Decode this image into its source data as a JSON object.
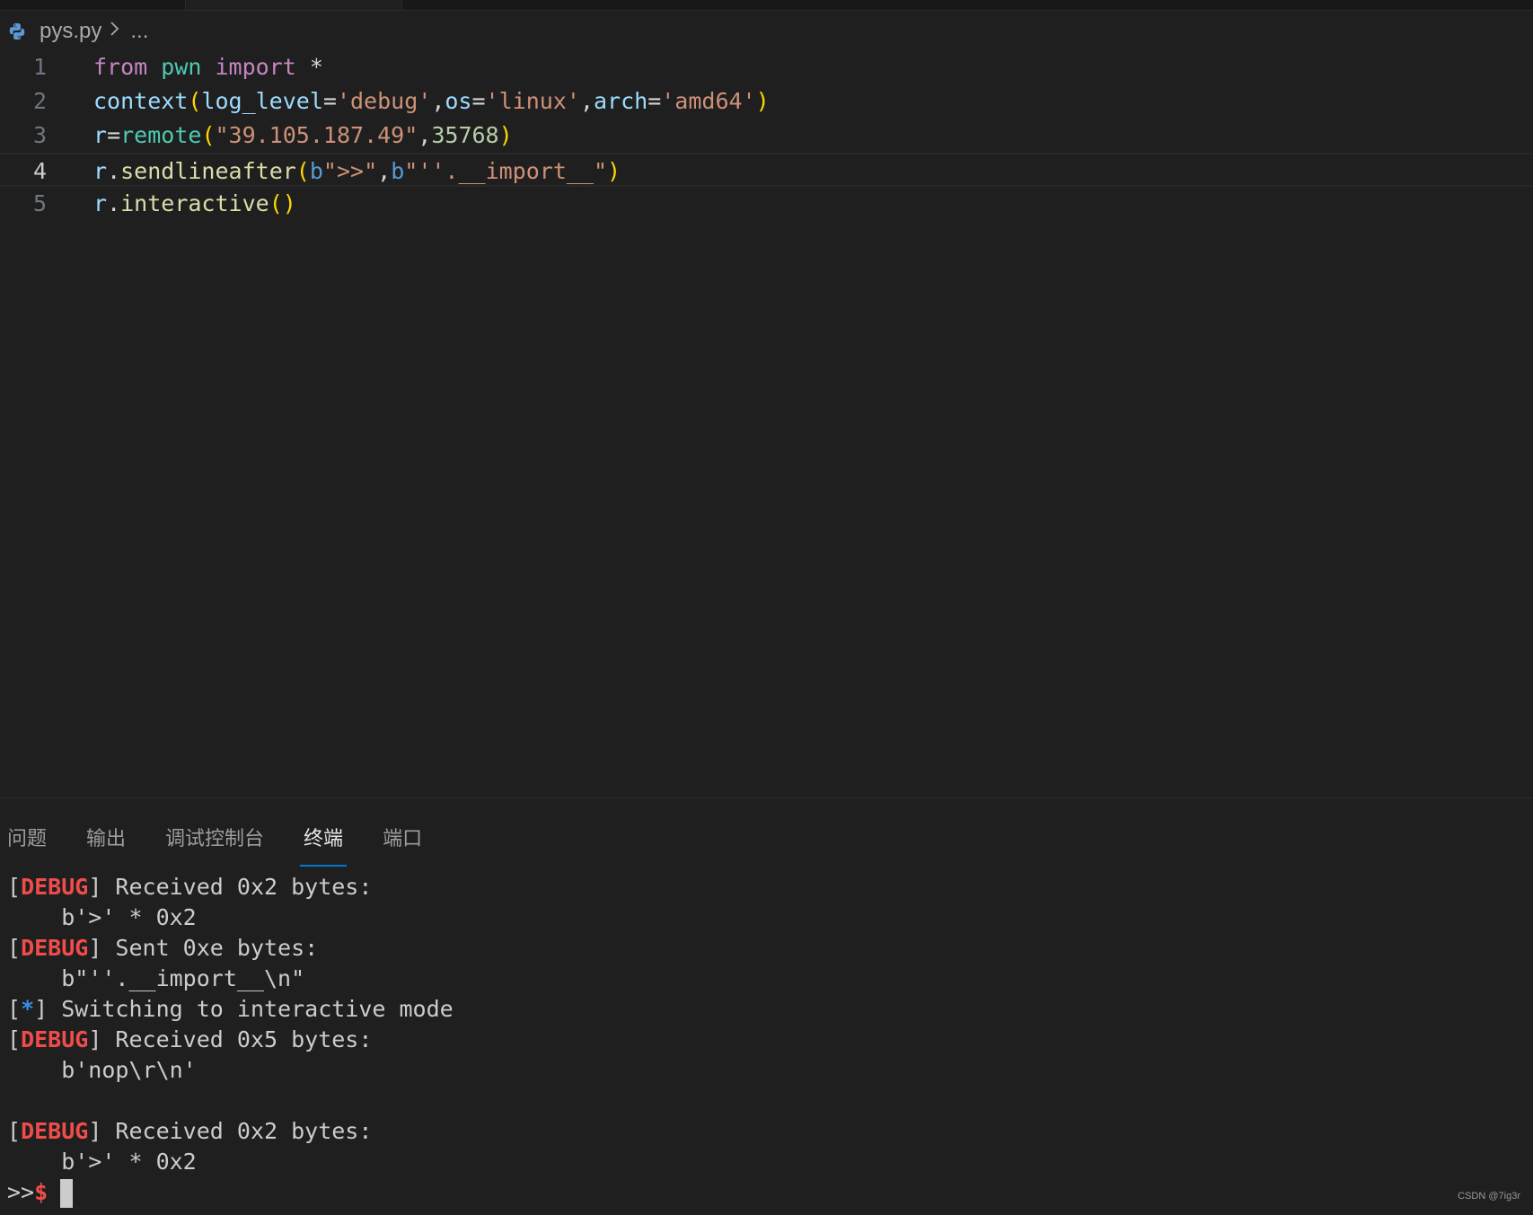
{
  "breadcrumb": {
    "file": "pys.py",
    "more": "...",
    "icon": "python-icon"
  },
  "editor": {
    "line_numbers": [
      "1",
      "2",
      "3",
      "4",
      "5"
    ],
    "current_line": 4,
    "lines": [
      [
        {
          "t": "from",
          "c": "kw"
        },
        {
          "t": " ",
          "c": "op"
        },
        {
          "t": "pwn",
          "c": "mod"
        },
        {
          "t": " ",
          "c": "op"
        },
        {
          "t": "import",
          "c": "kw"
        },
        {
          "t": " *",
          "c": "op"
        }
      ],
      [
        {
          "t": "context",
          "c": "var"
        },
        {
          "t": "(",
          "c": "br1"
        },
        {
          "t": "log_level",
          "c": "var"
        },
        {
          "t": "=",
          "c": "op"
        },
        {
          "t": "'debug'",
          "c": "str"
        },
        {
          "t": ",",
          "c": "op"
        },
        {
          "t": "os",
          "c": "var"
        },
        {
          "t": "=",
          "c": "op"
        },
        {
          "t": "'linux'",
          "c": "str"
        },
        {
          "t": ",",
          "c": "op"
        },
        {
          "t": "arch",
          "c": "var"
        },
        {
          "t": "=",
          "c": "op"
        },
        {
          "t": "'amd64'",
          "c": "str"
        },
        {
          "t": ")",
          "c": "br1"
        }
      ],
      [
        {
          "t": "r",
          "c": "var"
        },
        {
          "t": "=",
          "c": "op"
        },
        {
          "t": "remote",
          "c": "mod"
        },
        {
          "t": "(",
          "c": "br1"
        },
        {
          "t": "\"39.105.187.49\"",
          "c": "str"
        },
        {
          "t": ",",
          "c": "op"
        },
        {
          "t": "35768",
          "c": "num"
        },
        {
          "t": ")",
          "c": "br1"
        }
      ],
      [
        {
          "t": "r",
          "c": "var"
        },
        {
          "t": ".",
          "c": "op"
        },
        {
          "t": "sendlineafter",
          "c": "fn"
        },
        {
          "t": "(",
          "c": "br1"
        },
        {
          "t": "b",
          "c": "pfx"
        },
        {
          "t": "\">>\"",
          "c": "str"
        },
        {
          "t": ",",
          "c": "op"
        },
        {
          "t": "b",
          "c": "pfx"
        },
        {
          "t": "\"''.__import__\"",
          "c": "str"
        },
        {
          "t": ")",
          "c": "br1"
        }
      ],
      [
        {
          "t": "r",
          "c": "var"
        },
        {
          "t": ".",
          "c": "op"
        },
        {
          "t": "interactive",
          "c": "fn"
        },
        {
          "t": "()",
          "c": "br1"
        }
      ]
    ]
  },
  "panel": {
    "tabs": [
      "问题",
      "输出",
      "调试控制台",
      "终端",
      "端口"
    ],
    "active_tab": "终端",
    "terminal": [
      [
        {
          "t": "[",
          "c": ""
        },
        {
          "t": "DEBUG",
          "c": "dbg"
        },
        {
          "t": "] Received 0x2 bytes:",
          "c": ""
        }
      ],
      [
        {
          "t": "    b'>' * 0x2",
          "c": ""
        }
      ],
      [
        {
          "t": "[",
          "c": ""
        },
        {
          "t": "DEBUG",
          "c": "dbg"
        },
        {
          "t": "] Sent 0xe bytes:",
          "c": ""
        }
      ],
      [
        {
          "t": "    b\"''.__import__\\n\"",
          "c": ""
        }
      ],
      [
        {
          "t": "[",
          "c": ""
        },
        {
          "t": "*",
          "c": "star"
        },
        {
          "t": "] Switching to interactive mode",
          "c": ""
        }
      ],
      [
        {
          "t": "[",
          "c": ""
        },
        {
          "t": "DEBUG",
          "c": "dbg"
        },
        {
          "t": "] Received 0x5 bytes:",
          "c": ""
        }
      ],
      [
        {
          "t": "    b'nop\\r\\n'",
          "c": ""
        }
      ],
      [
        {
          "t": "",
          "c": ""
        }
      ],
      [
        {
          "t": "[",
          "c": ""
        },
        {
          "t": "DEBUG",
          "c": "dbg"
        },
        {
          "t": "] Received 0x2 bytes:",
          "c": ""
        }
      ],
      [
        {
          "t": "    b'>' * 0x2",
          "c": ""
        }
      ],
      [
        {
          "t": ">>",
          "c": ""
        },
        {
          "t": "$",
          "c": "dollar"
        }
      ]
    ]
  },
  "watermark": "CSDN @7ig3r"
}
